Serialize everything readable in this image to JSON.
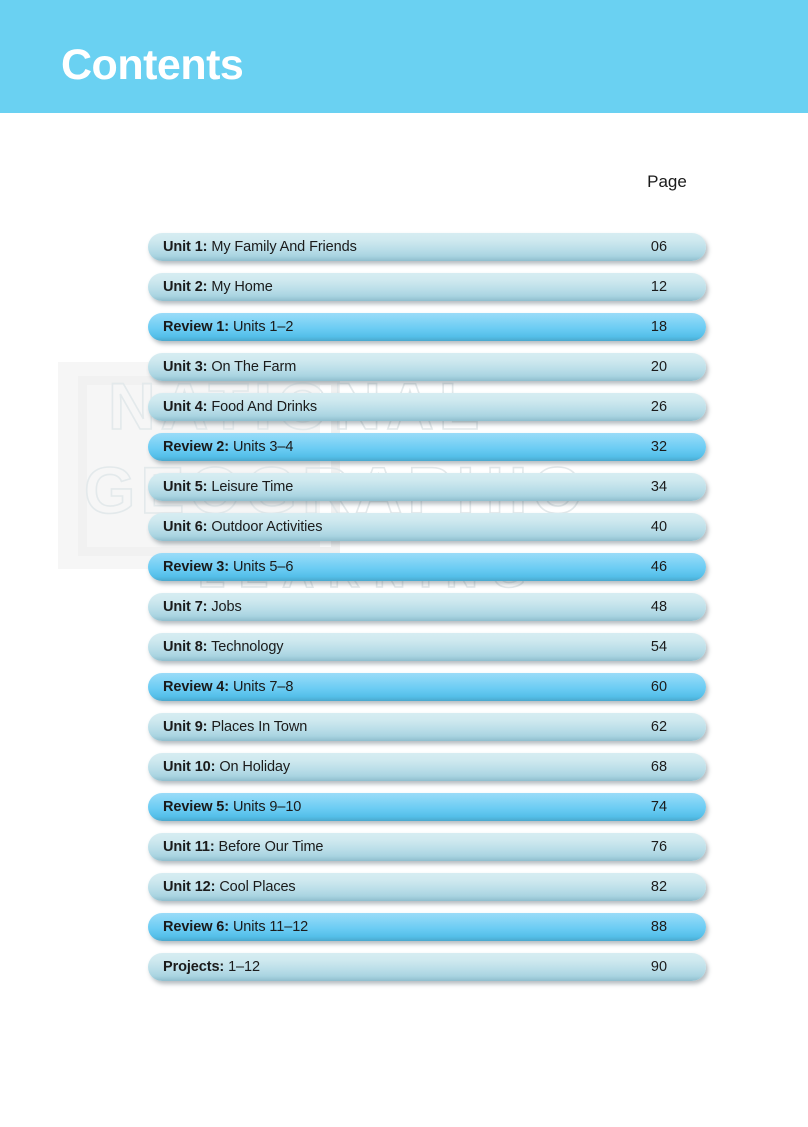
{
  "header": {
    "title": "Contents",
    "band_color": "#6ad1f2"
  },
  "column_header": {
    "page_label": "Page"
  },
  "watermark": {
    "line1": "NATIONAL",
    "line2": "GEOGRAPHIC",
    "line3": "LEARNING"
  },
  "toc": {
    "rows": [
      {
        "type": "unit",
        "lead": "Unit 1:",
        "title": "My Family And Friends",
        "page": "06"
      },
      {
        "type": "unit",
        "lead": "Unit 2:",
        "title": "My Home",
        "page": "12"
      },
      {
        "type": "review",
        "lead": "Review 1:",
        "title": "Units 1–2",
        "page": "18"
      },
      {
        "type": "unit",
        "lead": "Unit 3:",
        "title": "On The Farm",
        "page": "20"
      },
      {
        "type": "unit",
        "lead": "Unit 4:",
        "title": "Food And Drinks",
        "page": "26"
      },
      {
        "type": "review",
        "lead": "Review 2:",
        "title": "Units 3–4",
        "page": "32"
      },
      {
        "type": "unit",
        "lead": "Unit 5:",
        "title": "Leisure Time",
        "page": "34"
      },
      {
        "type": "unit",
        "lead": "Unit 6:",
        "title": "Outdoor Activities",
        "page": "40"
      },
      {
        "type": "review",
        "lead": "Review 3:",
        "title": "Units 5–6",
        "page": "46"
      },
      {
        "type": "unit",
        "lead": "Unit 7:",
        "title": "Jobs",
        "page": "48"
      },
      {
        "type": "unit",
        "lead": "Unit 8:",
        "title": "Technology",
        "page": "54"
      },
      {
        "type": "review",
        "lead": "Review 4:",
        "title": "Units 7–8",
        "page": "60"
      },
      {
        "type": "unit",
        "lead": "Unit 9:",
        "title": "Places In Town",
        "page": "62"
      },
      {
        "type": "unit",
        "lead": "Unit 10:",
        "title": "On Holiday",
        "page": "68"
      },
      {
        "type": "review",
        "lead": "Review 5:",
        "title": "Units 9–10",
        "page": "74"
      },
      {
        "type": "unit",
        "lead": "Unit 11:",
        "title": "Before Our Time",
        "page": "76"
      },
      {
        "type": "unit",
        "lead": "Unit 12:",
        "title": "Cool Places",
        "page": "82"
      },
      {
        "type": "review",
        "lead": "Review 6:",
        "title": "Units 11–12",
        "page": "88"
      },
      {
        "type": "unit",
        "lead": "Projects:",
        "title": "1–12",
        "page": "90"
      }
    ]
  },
  "colors": {
    "header_band": "#6ad1f2",
    "unit_row": "#c6e6ee",
    "review_row": "#74cff4",
    "text": "#1b1b1b"
  }
}
